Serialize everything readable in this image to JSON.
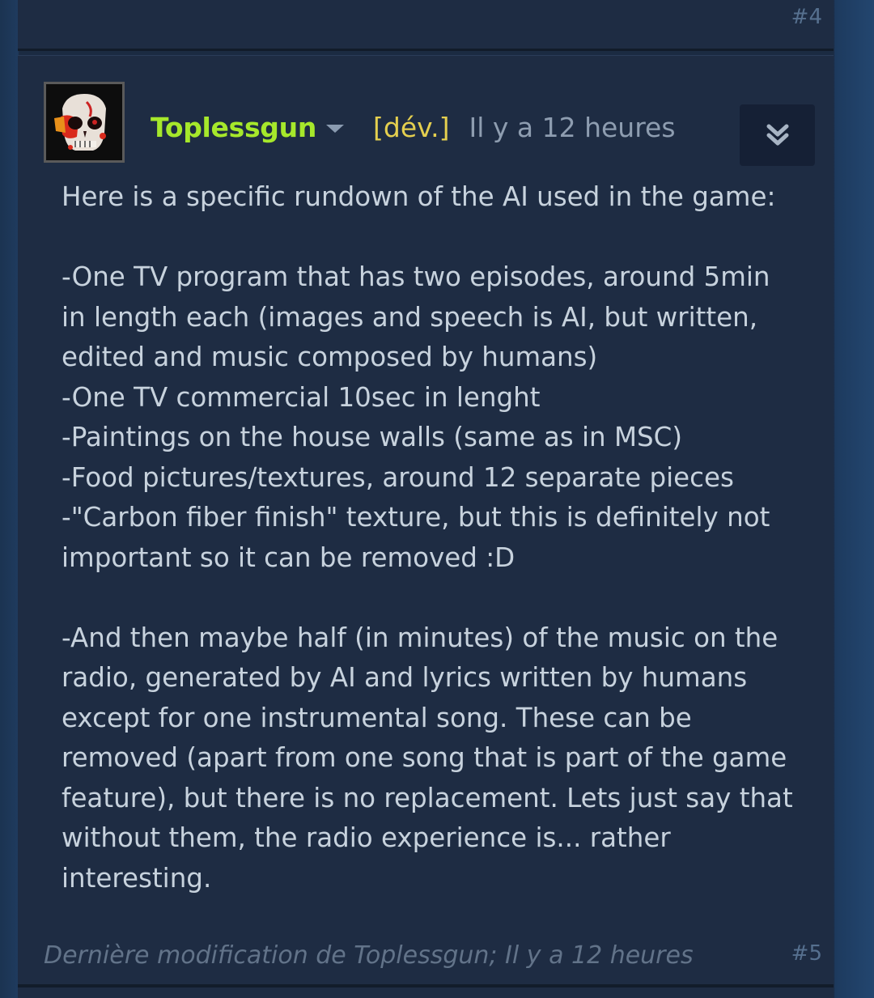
{
  "previous_post": {
    "number": "#4"
  },
  "post": {
    "author": "Toplessgun",
    "dev_tag": "[dév.]",
    "timestamp": "Il y a 12 heures",
    "body": "Here is a specific rundown of the AI used in the game:\n\n-One TV program that has two episodes, around 5min\nin length each (images and speech is AI, but written,\nedited and music composed by humans)\n-One TV commercial 10sec in lenght\n-Paintings on the house walls (same as in MSC)\n-Food pictures/textures, around 12 separate pieces\n-\"Carbon fiber finish\" texture, but this is definitely not\nimportant so it can be removed :D\n\n-And then maybe half (in minutes) of the music on the\nradio, generated by AI and lyrics written by humans\nexcept for one instrumental song. These can be\nremoved (apart from one song that is part of the game\nfeature), but there is no replacement. Lets just say that\nwithout them, the radio experience is... rather\ninteresting.",
    "edit_note": "Dernière modification de Toplessgun; Il y a 12 heures",
    "number": "#5"
  },
  "icons": {
    "author_menu": "chevron-down-icon",
    "expand": "double-chevron-down-icon",
    "avatar": "avatar-image"
  },
  "colors": {
    "author": "#a6e82b",
    "dev_tag": "#e4cf4f",
    "body_text": "#c7d2dd",
    "post_bg": "#1e2c43"
  }
}
